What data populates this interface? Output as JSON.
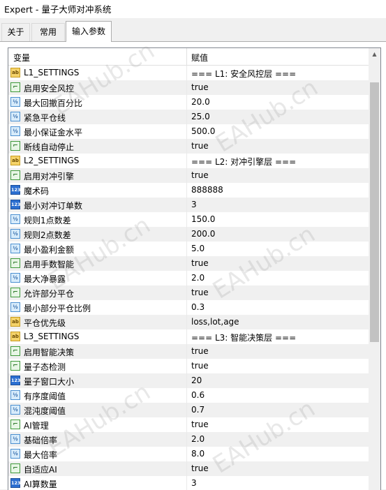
{
  "window": {
    "title": "Expert - 量子大师对冲系统"
  },
  "tabs": [
    {
      "label": "关于"
    },
    {
      "label": "常用"
    },
    {
      "label": "输入参数"
    }
  ],
  "grid": {
    "col_variable": "变量",
    "col_value": "赋值",
    "rows": [
      {
        "type": "ab",
        "name": "L1_SETTINGS",
        "value": "=== L1: 安全风控层 ==="
      },
      {
        "type": "bool",
        "name": "启用安全风控",
        "value": "true"
      },
      {
        "type": "frac",
        "name": "最大回撤百分比",
        "value": "20.0"
      },
      {
        "type": "frac",
        "name": "紧急平仓线",
        "value": "25.0"
      },
      {
        "type": "frac",
        "name": "最小保证金水平",
        "value": "500.0"
      },
      {
        "type": "bool",
        "name": "断线自动停止",
        "value": "true"
      },
      {
        "type": "ab",
        "name": "L2_SETTINGS",
        "value": "=== L2: 对冲引擎层 ==="
      },
      {
        "type": "bool",
        "name": "启用对冲引擎",
        "value": "true"
      },
      {
        "type": "int",
        "name": "魔术码",
        "value": "888888"
      },
      {
        "type": "int",
        "name": "最小对冲订单数",
        "value": "3"
      },
      {
        "type": "frac",
        "name": "规则1点数差",
        "value": "150.0"
      },
      {
        "type": "frac",
        "name": "规则2点数差",
        "value": "200.0"
      },
      {
        "type": "frac",
        "name": "最小盈利金额",
        "value": "5.0"
      },
      {
        "type": "bool",
        "name": "启用手数智能",
        "value": "true"
      },
      {
        "type": "frac",
        "name": "最大净暴露",
        "value": "2.0"
      },
      {
        "type": "bool",
        "name": "允许部分平仓",
        "value": "true"
      },
      {
        "type": "frac",
        "name": "最小部分平仓比例",
        "value": "0.3"
      },
      {
        "type": "ab",
        "name": "平仓优先级",
        "value": "loss,lot,age"
      },
      {
        "type": "ab",
        "name": "L3_SETTINGS",
        "value": "=== L3: 智能决策层 ==="
      },
      {
        "type": "bool",
        "name": "启用智能决策",
        "value": "true"
      },
      {
        "type": "bool",
        "name": "量子态检测",
        "value": "true"
      },
      {
        "type": "int",
        "name": "量子窗口大小",
        "value": "20"
      },
      {
        "type": "frac",
        "name": "有序度阈值",
        "value": "0.6"
      },
      {
        "type": "frac",
        "name": "混沌度阈值",
        "value": "0.7"
      },
      {
        "type": "bool",
        "name": "AI管理",
        "value": "true"
      },
      {
        "type": "frac",
        "name": "基础倍率",
        "value": "2.0"
      },
      {
        "type": "frac",
        "name": "最大倍率",
        "value": "8.0"
      },
      {
        "type": "bool",
        "name": "自适应AI",
        "value": "true"
      },
      {
        "type": "int",
        "name": "AI算数量",
        "value": "3"
      }
    ]
  },
  "icons": {
    "ab": {
      "name": "string-type-icon",
      "glyph": "ab"
    },
    "bool": {
      "name": "bool-type-icon",
      "glyph": "⌐"
    },
    "frac": {
      "name": "double-type-icon",
      "glyph": "½"
    },
    "int": {
      "name": "int-type-icon",
      "glyph": "123"
    }
  },
  "watermark": "EAHub.cn"
}
